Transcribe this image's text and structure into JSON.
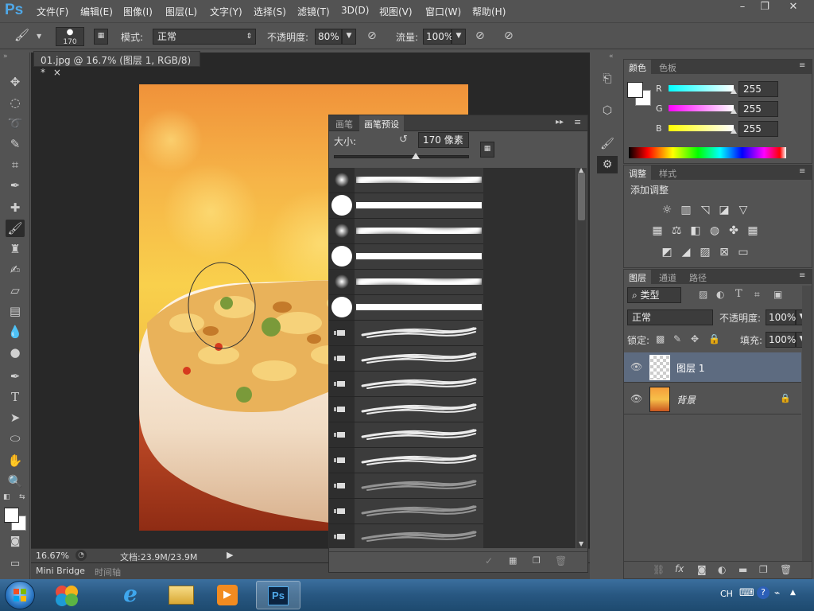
{
  "app": {
    "logo": "Ps",
    "menu": [
      "文件(F)",
      "编辑(E)",
      "图像(I)",
      "图层(L)",
      "文字(Y)",
      "选择(S)",
      "滤镜(T)",
      "3D(D)",
      "视图(V)",
      "窗口(W)",
      "帮助(H)"
    ]
  },
  "window_controls": {
    "minimize": "–",
    "restore": "❐",
    "close": "✕"
  },
  "options": {
    "brush_size": "170",
    "mode_label": "模式:",
    "mode_value": "正常",
    "opacity_label": "不透明度:",
    "opacity_value": "80%",
    "flow_label": "流量:",
    "flow_value": "100%"
  },
  "document": {
    "tab_title": "01.jpg @ 16.7% (图层 1, RGB/8) *",
    "close": "×",
    "zoom": "16.67%",
    "doc_info": "文档:23.9M/23.9M"
  },
  "bottom_tabs": {
    "mini_bridge": "Mini Bridge",
    "timeline": "时间轴"
  },
  "brush_panel": {
    "tabs": [
      "画笔",
      "画笔预设"
    ],
    "size_label": "大小:",
    "size_value": "170 像素",
    "size_slider_fraction": 0.6,
    "rows": 15
  },
  "color_panel": {
    "tabs": [
      "颜色",
      "色板"
    ],
    "r_label": "R",
    "g_label": "G",
    "b_label": "B",
    "r": "255",
    "g": "255",
    "b": "255",
    "r_fraction": 1.0,
    "g_fraction": 1.0,
    "b_fraction": 1.0,
    "fg_color": "#ffffff",
    "bg_color": "#ffffff"
  },
  "adjust_panel": {
    "tabs": [
      "调整",
      "样式"
    ],
    "title": "添加调整"
  },
  "layers_panel": {
    "tabs": [
      "图层",
      "通道",
      "路径"
    ],
    "filter_value": "类型",
    "blend_value": "正常",
    "opacity_label": "不透明度:",
    "opacity_value": "100%",
    "lock_label": "锁定:",
    "fill_label": "填充:",
    "fill_value": "100%",
    "layers": [
      {
        "name": "图层 1"
      },
      {
        "name": "背景"
      }
    ]
  },
  "taskbar": {
    "ime": "CH"
  }
}
